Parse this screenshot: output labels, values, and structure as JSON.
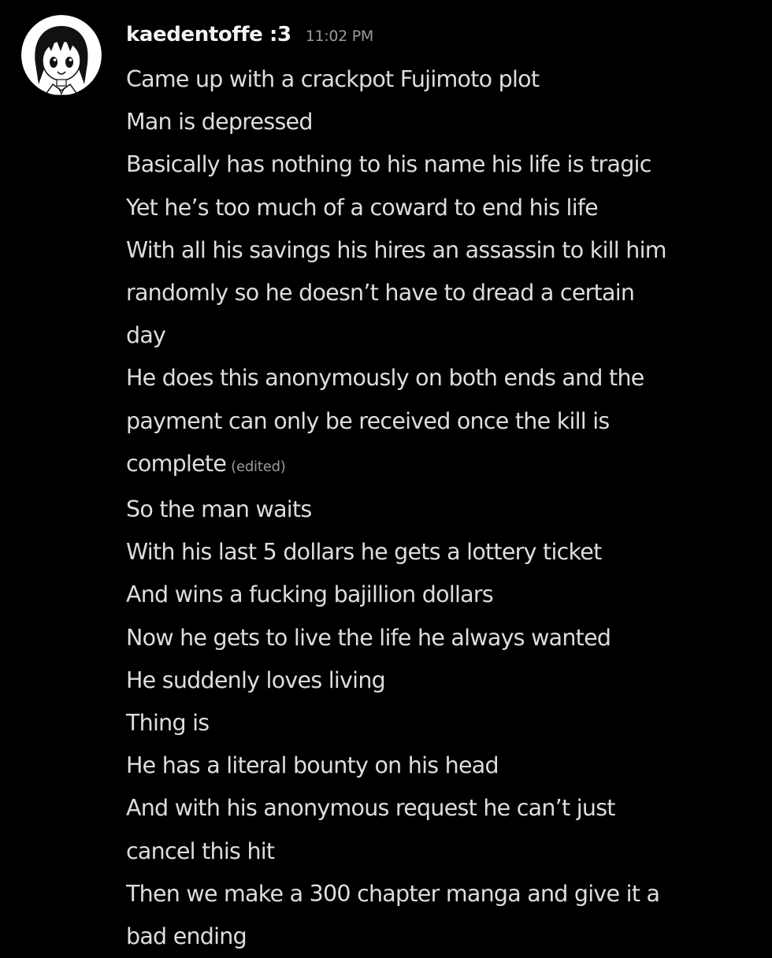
{
  "colors": {
    "background": "#000000",
    "username": "#f2f3f5",
    "message_text": "#dbdee1",
    "muted": "#949ba4"
  },
  "message": {
    "username": "kaedentoffe :3",
    "timestamp": "11:02 PM",
    "avatar_icon": "anime-girl-avatar-icon",
    "edited_label": "(edited)",
    "lines": [
      "Came up with a crackpot Fujimoto plot",
      "Man is depressed",
      "Basically has nothing to his name his life is tragic",
      "Yet he’s too much of a coward to end his life",
      "With all his savings his hires an assassin to kill him",
      "randomly so he doesn’t have to dread a certain",
      "day",
      "He does this anonymously on both ends and the",
      "payment can only be received once the kill is",
      "complete",
      "So the man waits",
      "With his last 5 dollars he gets a lottery ticket",
      "And wins a fucking bajillion dollars",
      "Now he gets to live the life he always wanted",
      "He suddenly loves living",
      "Thing is",
      "He has a literal bounty on his head",
      "And with his anonymous request he can’t just",
      "cancel this hit",
      "Then we make a 300 chapter manga and give it a",
      "bad ending"
    ]
  }
}
